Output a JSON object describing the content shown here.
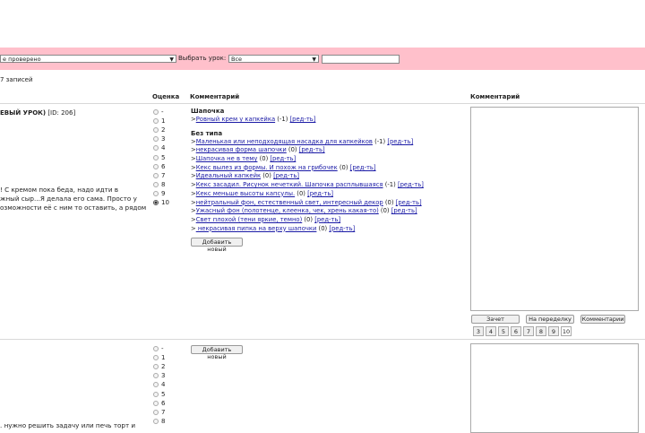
{
  "filter": {
    "status_value": "е проверено",
    "lesson_label": "Выбрать урок:",
    "lesson_value": "Все",
    "text_value": ""
  },
  "records_count": "7 записей",
  "columns": {
    "grade": "Оценка",
    "comment": "Комментарий",
    "comment2": "Комментарий"
  },
  "row1": {
    "title": "ЕВЫЙ УРОК)",
    "id": "[ID: 206]",
    "text_lines": [
      "! С кремом пока беда, надо идти в",
      "жный сыр...Я делала его сама. Просто у",
      "озможности её с ним то оставить, а рядом"
    ],
    "grades": [
      "-",
      "1",
      "2",
      "3",
      "4",
      "5",
      "6",
      "7",
      "8",
      "9",
      "10"
    ],
    "selected_grade": "10",
    "section1": "Шапочка",
    "section1_items": [
      {
        "prefix": ">",
        "link": "Ровный крем у капкейка",
        "score": " (-1)",
        "edit": "[ред-ть]"
      }
    ],
    "section2": "Без типа",
    "section2_items": [
      {
        "prefix": ">",
        "link": "Маленькая или неподходящая насадка для капкейков",
        "score": " (-1)",
        "edit": "[ред-ть]"
      },
      {
        "prefix": ">",
        "link": "некрасивая форма шапочки",
        "score": " (0)",
        "edit": "[ред-ть]"
      },
      {
        "prefix": ">",
        "link": "Шапочка не в тему",
        "score": " (0)",
        "edit": "[ред-ть]"
      },
      {
        "prefix": ">",
        "link": "Кекс вылез из формы. И похож на грибочек",
        "score": " (0)",
        "edit": "[ред-ть]"
      },
      {
        "prefix": ">",
        "link": "Идеальный капкейк",
        "score": " (0)",
        "edit": "[ред-ть]"
      },
      {
        "prefix": ">",
        "link": "Кекс засадил. Рисунок нечеткий. Шапочка расплывшаяся",
        "score": " (-1)",
        "edit": "[ред-ть]"
      },
      {
        "prefix": ">",
        "link": "Кекс меньше высоты капсулы.",
        "score": " (0)",
        "edit": "[ред-ть]"
      },
      {
        "prefix": ">",
        "link": "нейтральный фон, естественный свет, интересный декор",
        "score": " (0)",
        "edit": "[ред-ть]"
      },
      {
        "prefix": ">",
        "link": "Ужасный фон (полотенце, клеенка, чек, хрень какая-то)",
        "score": " (0)",
        "edit": "[ред-ть]"
      },
      {
        "prefix": ">",
        "link": "Свет плохой (тени яркие, темно)",
        "score": " (0)",
        "edit": "[ред-ть]"
      },
      {
        "prefix": ">",
        "link": " некрасивая пипка на верху шапочки",
        "score": " (0)",
        "edit": "[ред-ть]"
      }
    ],
    "add_new": "Добавить новый",
    "buttons": {
      "credit": "Зачет",
      "redo": "На переделку",
      "comments": "Комментарии"
    },
    "numbers": [
      "3",
      "4",
      "5",
      "6",
      "7",
      "8",
      "9",
      "10"
    ]
  },
  "row2": {
    "grades": [
      "-",
      "1",
      "2",
      "3",
      "4",
      "5",
      "6",
      "7",
      "8"
    ],
    "add_new": "Добавить новый",
    "text_line": ". нужно решить задачу или печь торт и"
  }
}
